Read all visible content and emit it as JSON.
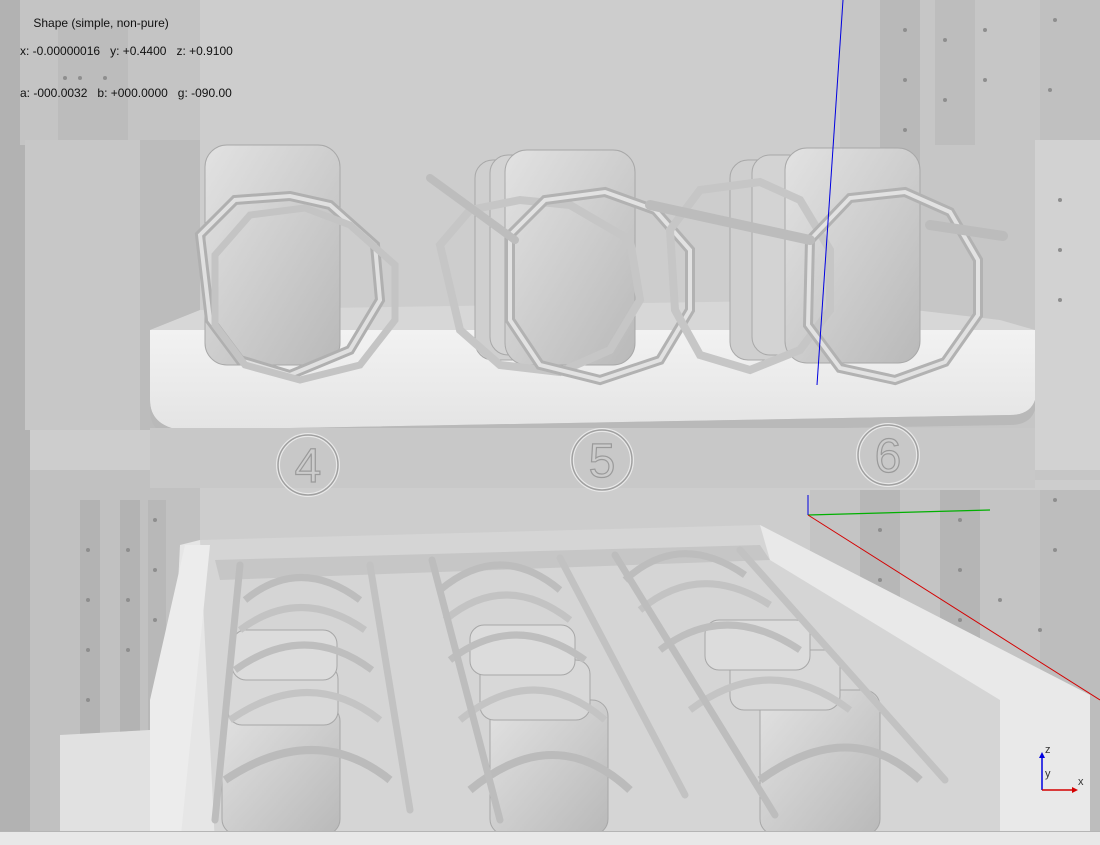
{
  "viewer": {
    "shape_label": "Shape (simple, non-pure)",
    "coords": {
      "x": "x: -0.00000016",
      "y": "y: +0.4400",
      "z": "z: +0.9100"
    },
    "angles": {
      "a": "a: -000.0032",
      "b": "b: +000.0000",
      "g": "g: -090.00"
    }
  },
  "shelf_labels": [
    "4",
    "5",
    "6"
  ],
  "gizmo": {
    "z": "z",
    "y": "y",
    "x": "x"
  },
  "colors": {
    "background": "#cfcfcf",
    "axis_x": "#d40000",
    "axis_y": "#00b000",
    "axis_z": "#0000e0"
  }
}
